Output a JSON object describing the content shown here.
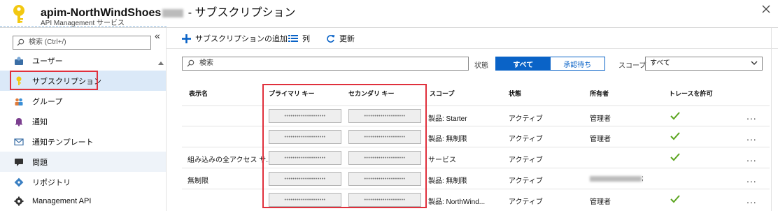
{
  "header": {
    "title_name": "apim-NorthWindShoes",
    "title_suffix": " - サブスクリプション",
    "subtitle": "API Management サービス",
    "close_icon": "close-icon"
  },
  "sidebar": {
    "search_placeholder": "検索 (Ctrl+/)",
    "collapse_label": "«",
    "items": [
      {
        "label": "ユーザー",
        "icon": "user-icon"
      },
      {
        "label": "サブスクリプション",
        "icon": "key-icon"
      },
      {
        "label": "グループ",
        "icon": "group-icon"
      },
      {
        "label": "通知",
        "icon": "bell-icon"
      },
      {
        "label": "通知テンプレート",
        "icon": "mail-icon"
      },
      {
        "label": "問題",
        "icon": "chat-icon"
      },
      {
        "label": "リポジトリ",
        "icon": "git-icon"
      },
      {
        "label": "Management API",
        "icon": "api-icon"
      }
    ]
  },
  "toolbar": {
    "add_label": "サブスクリプションの追加",
    "columns_label": "列",
    "refresh_label": "更新"
  },
  "filters": {
    "search_placeholder": "検索",
    "status_label": "状態",
    "status_options": [
      "すべて",
      "承認待ち"
    ],
    "status_selected": "すべて",
    "scope_label": "スコープ",
    "scope_value": "すべて"
  },
  "table": {
    "headers": [
      "表示名",
      "プライマリ キー",
      "セカンダリ キー",
      "スコープ",
      "状態",
      "所有者",
      "トレースを許可"
    ],
    "rows": [
      {
        "display_name": "",
        "primary_key": "••••••••••••••••••••",
        "secondary_key": "••••••••••••••••••••",
        "scope": "製品: Starter",
        "state": "アクティブ",
        "owner": "管理者",
        "trace": true
      },
      {
        "display_name": "",
        "primary_key": "••••••••••••••••••••",
        "secondary_key": "••••••••••••••••••••",
        "scope": "製品: 無制限",
        "state": "アクティブ",
        "owner": "管理者",
        "trace": true
      },
      {
        "display_name": "組み込みの全アクセス サ...",
        "primary_key": "••••••••••••••••••••",
        "secondary_key": "••••••••••••••••••••",
        "scope": "サービス",
        "state": "アクティブ",
        "owner": "",
        "trace": true
      },
      {
        "display_name": "無制限",
        "primary_key": "••••••••••••••••••••",
        "secondary_key": "••••••••••••••••••••",
        "scope": "製品: 無制限",
        "state": "アクティブ",
        "owner": ";",
        "trace": false
      },
      {
        "display_name": "",
        "primary_key": "••••••••••••••••••••",
        "secondary_key": "••••••••••••••••••••",
        "scope": "製品: NorthWind...",
        "state": "アクティブ",
        "owner": "管理者",
        "trace": true
      }
    ],
    "more_label": "...",
    "colors": {
      "check": "#5aa41e",
      "accent": "#0a63c7",
      "highlight": "#e0303c"
    }
  }
}
